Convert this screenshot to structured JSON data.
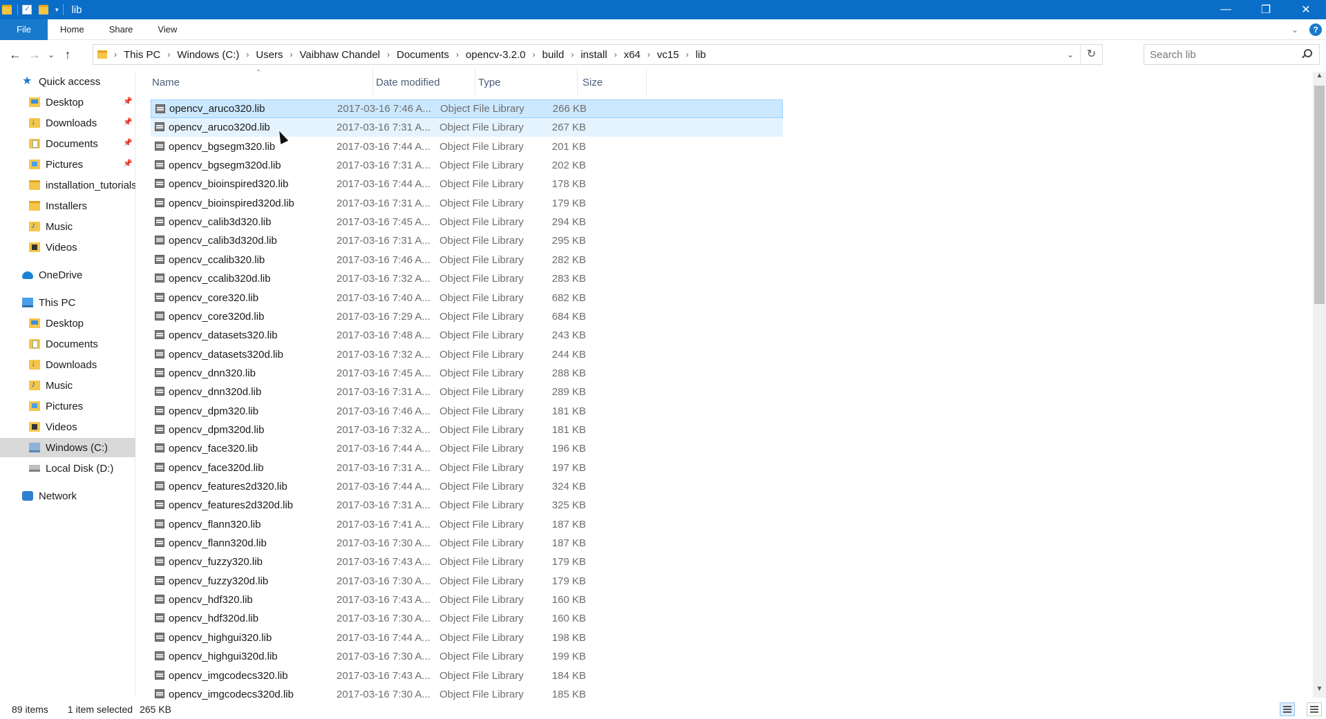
{
  "window": {
    "title": "lib",
    "minimize": "—",
    "maximize": "❐",
    "close": "✕"
  },
  "ribbon": {
    "tabs": [
      "File",
      "Home",
      "Share",
      "View"
    ]
  },
  "address": {
    "breadcrumbs": [
      "This PC",
      "Windows (C:)",
      "Users",
      "Vaibhaw Chandel",
      "Documents",
      "opencv-3.2.0",
      "build",
      "install",
      "x64",
      "vc15",
      "lib"
    ]
  },
  "search": {
    "placeholder": "Search lib"
  },
  "nav": {
    "items": [
      {
        "label": "Quick access",
        "icon": "star-icon",
        "pinned": false
      },
      {
        "label": "Desktop",
        "icon": "desktop-folder-icon",
        "pinned": true
      },
      {
        "label": "Downloads",
        "icon": "downloads-folder-icon",
        "pinned": true
      },
      {
        "label": "Documents",
        "icon": "documents-folder-icon",
        "pinned": true
      },
      {
        "label": "Pictures",
        "icon": "pictures-folder-icon",
        "pinned": true
      },
      {
        "label": "installation_tutorials",
        "icon": "folder-icon",
        "pinned": false
      },
      {
        "label": "Installers",
        "icon": "folder-icon",
        "pinned": false
      },
      {
        "label": "Music",
        "icon": "music-folder-icon",
        "pinned": false
      },
      {
        "label": "Videos",
        "icon": "videos-folder-icon",
        "pinned": false
      },
      {
        "label": "OneDrive",
        "icon": "onedrive-icon",
        "pinned": false
      },
      {
        "label": "This PC",
        "icon": "this-pc-icon",
        "pinned": false
      },
      {
        "label": "Desktop",
        "icon": "desktop-folder-icon",
        "pinned": false
      },
      {
        "label": "Documents",
        "icon": "documents-folder-icon",
        "pinned": false
      },
      {
        "label": "Downloads",
        "icon": "downloads-folder-icon",
        "pinned": false
      },
      {
        "label": "Music",
        "icon": "music-folder-icon",
        "pinned": false
      },
      {
        "label": "Pictures",
        "icon": "pictures-folder-icon",
        "pinned": false
      },
      {
        "label": "Videos",
        "icon": "videos-folder-icon",
        "pinned": false
      },
      {
        "label": "Windows (C:)",
        "icon": "windows-drive-icon",
        "pinned": false,
        "selected": true
      },
      {
        "label": "Local Disk (D:)",
        "icon": "local-disk-icon",
        "pinned": false
      },
      {
        "label": "Network",
        "icon": "network-icon",
        "pinned": false
      }
    ]
  },
  "columns": {
    "name": "Name",
    "date": "Date modified",
    "type": "Type",
    "size": "Size"
  },
  "files": [
    {
      "name": "opencv_aruco320.lib",
      "date": "2017-03-16 7:46 A...",
      "type": "Object File Library",
      "size": "266 KB",
      "selected": true
    },
    {
      "name": "opencv_aruco320d.lib",
      "date": "2017-03-16 7:31 A...",
      "type": "Object File Library",
      "size": "267 KB",
      "hover": true
    },
    {
      "name": "opencv_bgsegm320.lib",
      "date": "2017-03-16 7:44 A...",
      "type": "Object File Library",
      "size": "201 KB"
    },
    {
      "name": "opencv_bgsegm320d.lib",
      "date": "2017-03-16 7:31 A...",
      "type": "Object File Library",
      "size": "202 KB"
    },
    {
      "name": "opencv_bioinspired320.lib",
      "date": "2017-03-16 7:44 A...",
      "type": "Object File Library",
      "size": "178 KB"
    },
    {
      "name": "opencv_bioinspired320d.lib",
      "date": "2017-03-16 7:31 A...",
      "type": "Object File Library",
      "size": "179 KB"
    },
    {
      "name": "opencv_calib3d320.lib",
      "date": "2017-03-16 7:45 A...",
      "type": "Object File Library",
      "size": "294 KB"
    },
    {
      "name": "opencv_calib3d320d.lib",
      "date": "2017-03-16 7:31 A...",
      "type": "Object File Library",
      "size": "295 KB"
    },
    {
      "name": "opencv_ccalib320.lib",
      "date": "2017-03-16 7:46 A...",
      "type": "Object File Library",
      "size": "282 KB"
    },
    {
      "name": "opencv_ccalib320d.lib",
      "date": "2017-03-16 7:32 A...",
      "type": "Object File Library",
      "size": "283 KB"
    },
    {
      "name": "opencv_core320.lib",
      "date": "2017-03-16 7:40 A...",
      "type": "Object File Library",
      "size": "682 KB"
    },
    {
      "name": "opencv_core320d.lib",
      "date": "2017-03-16 7:29 A...",
      "type": "Object File Library",
      "size": "684 KB"
    },
    {
      "name": "opencv_datasets320.lib",
      "date": "2017-03-16 7:48 A...",
      "type": "Object File Library",
      "size": "243 KB"
    },
    {
      "name": "opencv_datasets320d.lib",
      "date": "2017-03-16 7:32 A...",
      "type": "Object File Library",
      "size": "244 KB"
    },
    {
      "name": "opencv_dnn320.lib",
      "date": "2017-03-16 7:45 A...",
      "type": "Object File Library",
      "size": "288 KB"
    },
    {
      "name": "opencv_dnn320d.lib",
      "date": "2017-03-16 7:31 A...",
      "type": "Object File Library",
      "size": "289 KB"
    },
    {
      "name": "opencv_dpm320.lib",
      "date": "2017-03-16 7:46 A...",
      "type": "Object File Library",
      "size": "181 KB"
    },
    {
      "name": "opencv_dpm320d.lib",
      "date": "2017-03-16 7:32 A...",
      "type": "Object File Library",
      "size": "181 KB"
    },
    {
      "name": "opencv_face320.lib",
      "date": "2017-03-16 7:44 A...",
      "type": "Object File Library",
      "size": "196 KB"
    },
    {
      "name": "opencv_face320d.lib",
      "date": "2017-03-16 7:31 A...",
      "type": "Object File Library",
      "size": "197 KB"
    },
    {
      "name": "opencv_features2d320.lib",
      "date": "2017-03-16 7:44 A...",
      "type": "Object File Library",
      "size": "324 KB"
    },
    {
      "name": "opencv_features2d320d.lib",
      "date": "2017-03-16 7:31 A...",
      "type": "Object File Library",
      "size": "325 KB"
    },
    {
      "name": "opencv_flann320.lib",
      "date": "2017-03-16 7:41 A...",
      "type": "Object File Library",
      "size": "187 KB"
    },
    {
      "name": "opencv_flann320d.lib",
      "date": "2017-03-16 7:30 A...",
      "type": "Object File Library",
      "size": "187 KB"
    },
    {
      "name": "opencv_fuzzy320.lib",
      "date": "2017-03-16 7:43 A...",
      "type": "Object File Library",
      "size": "179 KB"
    },
    {
      "name": "opencv_fuzzy320d.lib",
      "date": "2017-03-16 7:30 A...",
      "type": "Object File Library",
      "size": "179 KB"
    },
    {
      "name": "opencv_hdf320.lib",
      "date": "2017-03-16 7:43 A...",
      "type": "Object File Library",
      "size": "160 KB"
    },
    {
      "name": "opencv_hdf320d.lib",
      "date": "2017-03-16 7:30 A...",
      "type": "Object File Library",
      "size": "160 KB"
    },
    {
      "name": "opencv_highgui320.lib",
      "date": "2017-03-16 7:44 A...",
      "type": "Object File Library",
      "size": "198 KB"
    },
    {
      "name": "opencv_highgui320d.lib",
      "date": "2017-03-16 7:30 A...",
      "type": "Object File Library",
      "size": "199 KB"
    },
    {
      "name": "opencv_imgcodecs320.lib",
      "date": "2017-03-16 7:43 A...",
      "type": "Object File Library",
      "size": "184 KB"
    },
    {
      "name": "opencv_imgcodecs320d.lib",
      "date": "2017-03-16 7:30 A...",
      "type": "Object File Library",
      "size": "185 KB"
    }
  ],
  "status": {
    "item_count": "89 items",
    "selection": "1 item selected",
    "selection_size": "265 KB"
  },
  "colors": {
    "titlebar": "#0a6dc7",
    "file_tab": "#1979ca",
    "selection": "#cce8ff",
    "hover": "#e5f3ff"
  }
}
